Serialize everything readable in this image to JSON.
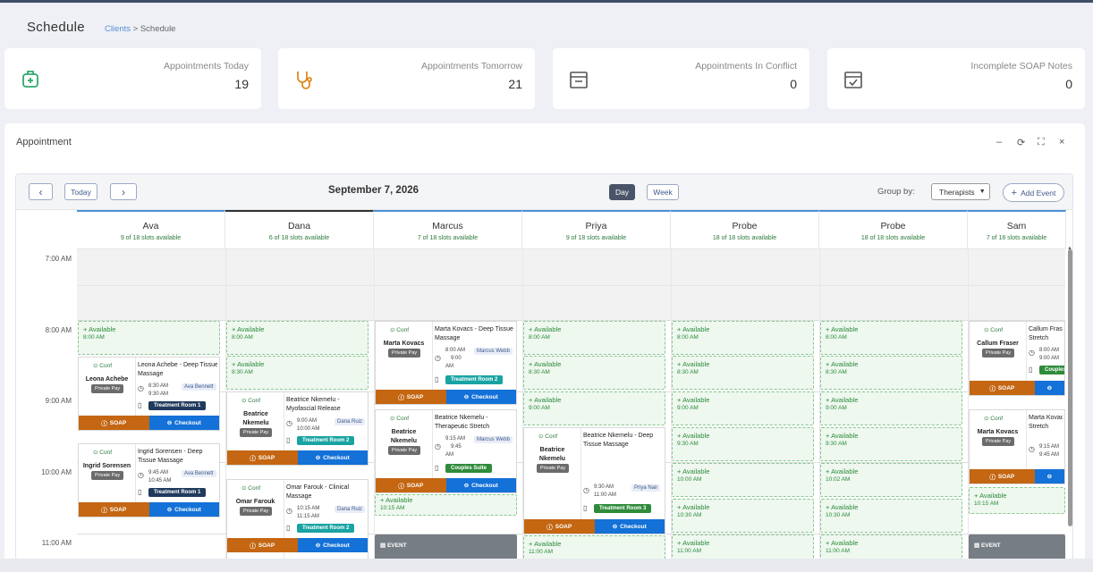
{
  "page": {
    "title": "Schedule",
    "breadcrumb_link": "Clients",
    "breadcrumb_sep": ">",
    "breadcrumb_current": "Schedule"
  },
  "stats": [
    {
      "label": "Appointments Today",
      "value": "19",
      "icon": "ambulance-icon",
      "color": "#2faa6b"
    },
    {
      "label": "Appointments Tomorrow",
      "value": "21",
      "icon": "stethoscope-icon",
      "color": "#e08a1e"
    },
    {
      "label": "Appointments In Conflict",
      "value": "0",
      "icon": "calendar-minus-icon",
      "color": "#555555"
    },
    {
      "label": "Incomplete SOAP Notes",
      "value": "0",
      "icon": "calendar-check-icon",
      "color": "#555555"
    }
  ],
  "panel": {
    "title": "Appointment",
    "controls": [
      "–",
      "⟳",
      "⛶",
      "×"
    ]
  },
  "toolbar": {
    "prev": "‹",
    "today": "Today",
    "next": "›",
    "date": "September 7, 2026",
    "day": "Day",
    "week": "Week",
    "group_label": "Group by:",
    "group_value": "Therapists",
    "add_event": "Add Event"
  },
  "times": [
    "7:00 AM",
    "8:00 AM",
    "9:00 AM",
    "10:00 AM",
    "11:00 AM"
  ],
  "columns": [
    {
      "name": "Ava",
      "slots": "9 of 18 slots available"
    },
    {
      "name": "Dana",
      "slots": "6 of 18 slots available"
    },
    {
      "name": "Marcus",
      "slots": "7 of 18 slots available"
    },
    {
      "name": "Priya",
      "slots": "9 of 18 slots available"
    },
    {
      "name": "Probe",
      "slots": "18 of 18 slots available"
    },
    {
      "name": "Probe",
      "slots": "18 of 18 slots available"
    },
    {
      "name": "Sam",
      "slots": "7 of 18 slots available"
    }
  ],
  "labels": {
    "available": "Available",
    "conf": "Conf",
    "private_pay": "Private Pay",
    "soap": "SOAP",
    "checkout": "Checkout",
    "event": "EVENT"
  },
  "slot_times": [
    "8:00 AM",
    "8:30 AM",
    "9:00 AM",
    "9:30 AM",
    "10:00 AM",
    "10:30 AM",
    "11:00 AM",
    "10:15 AM",
    "10:02 AM"
  ],
  "appointments": [
    {
      "patient": "Leona Achebe",
      "service": [
        "Leona Achebe - Deep Tissue",
        "Massage"
      ],
      "t1": "8:30 AM",
      "t2": "9:30 AM",
      "therapist": "Ava Bennett",
      "room": "Treatment Room 1",
      "room_color": "#1f3a5c"
    },
    {
      "patient": "Ingrid Sorensen",
      "service": [
        "Ingrid Sorensen - Deep",
        "Tissue Massage"
      ],
      "t1": "9:45 AM",
      "t2": "10:45 AM",
      "therapist": "Ava Bennett",
      "room": "Treatment Room 1",
      "room_color": "#1f3a5c"
    },
    {
      "patient": "Beatrice Nkemelu",
      "service": [
        "Beatrice Nkemelu -",
        "Myofascial Release"
      ],
      "t1": "9:00 AM",
      "t2": "10:00 AM",
      "therapist": "Dana Ruiz",
      "room": "Treatment Room 2",
      "room_color": "#1aa3a3"
    },
    {
      "patient": "Omar Farouk",
      "service": [
        "Omar Farouk - Clinical",
        "Massage"
      ],
      "t1": "10:15 AM",
      "t2": "11:15 AM",
      "therapist": "Dana Ruiz",
      "room": "Treatment Room 2",
      "room_color": "#1aa3a3"
    },
    {
      "patient": "Marta Kovacs",
      "service": [
        "Marta Kovacs - Deep Tissue",
        "Massage"
      ],
      "t1": "8:00 AM",
      "t2": "9:00",
      "t3": "AM",
      "therapist": "Marcus Webb",
      "room": "Treatment Room 2",
      "room_color": "#1aa3a3"
    },
    {
      "patient": "Beatrice Nkemelu",
      "service": [
        "Beatrice Nkemelu -",
        "Therapeutic Stretch"
      ],
      "t1": "9:15 AM",
      "t2": "9:45",
      "t3": "AM",
      "therapist": "Marcus Webb",
      "room": "Couples Suite",
      "room_color": "#2e8b3a"
    },
    {
      "patient": "Beatrice Nkemelu",
      "service": [
        "Beatrice Nkemelu - Deep",
        "Tissue Massage"
      ],
      "t1": "9:30 AM",
      "t2": "11:00 AM",
      "therapist": "Priya Nair",
      "room": "Treatment Room 3",
      "room_color": "#2e8b3a"
    },
    {
      "patient": "Callum Fraser",
      "service": [
        "Callum Fras",
        "Stretch"
      ],
      "t1": "8:00 AM",
      "t2": "9:00 AM",
      "room": "Couples",
      "room_color": "#2e8b3a"
    },
    {
      "patient": "Marta Kovacs",
      "service": [
        "Marta Kovac",
        "Stretch"
      ],
      "t1": "9:15 AM",
      "t2": "9:45 AM"
    }
  ]
}
